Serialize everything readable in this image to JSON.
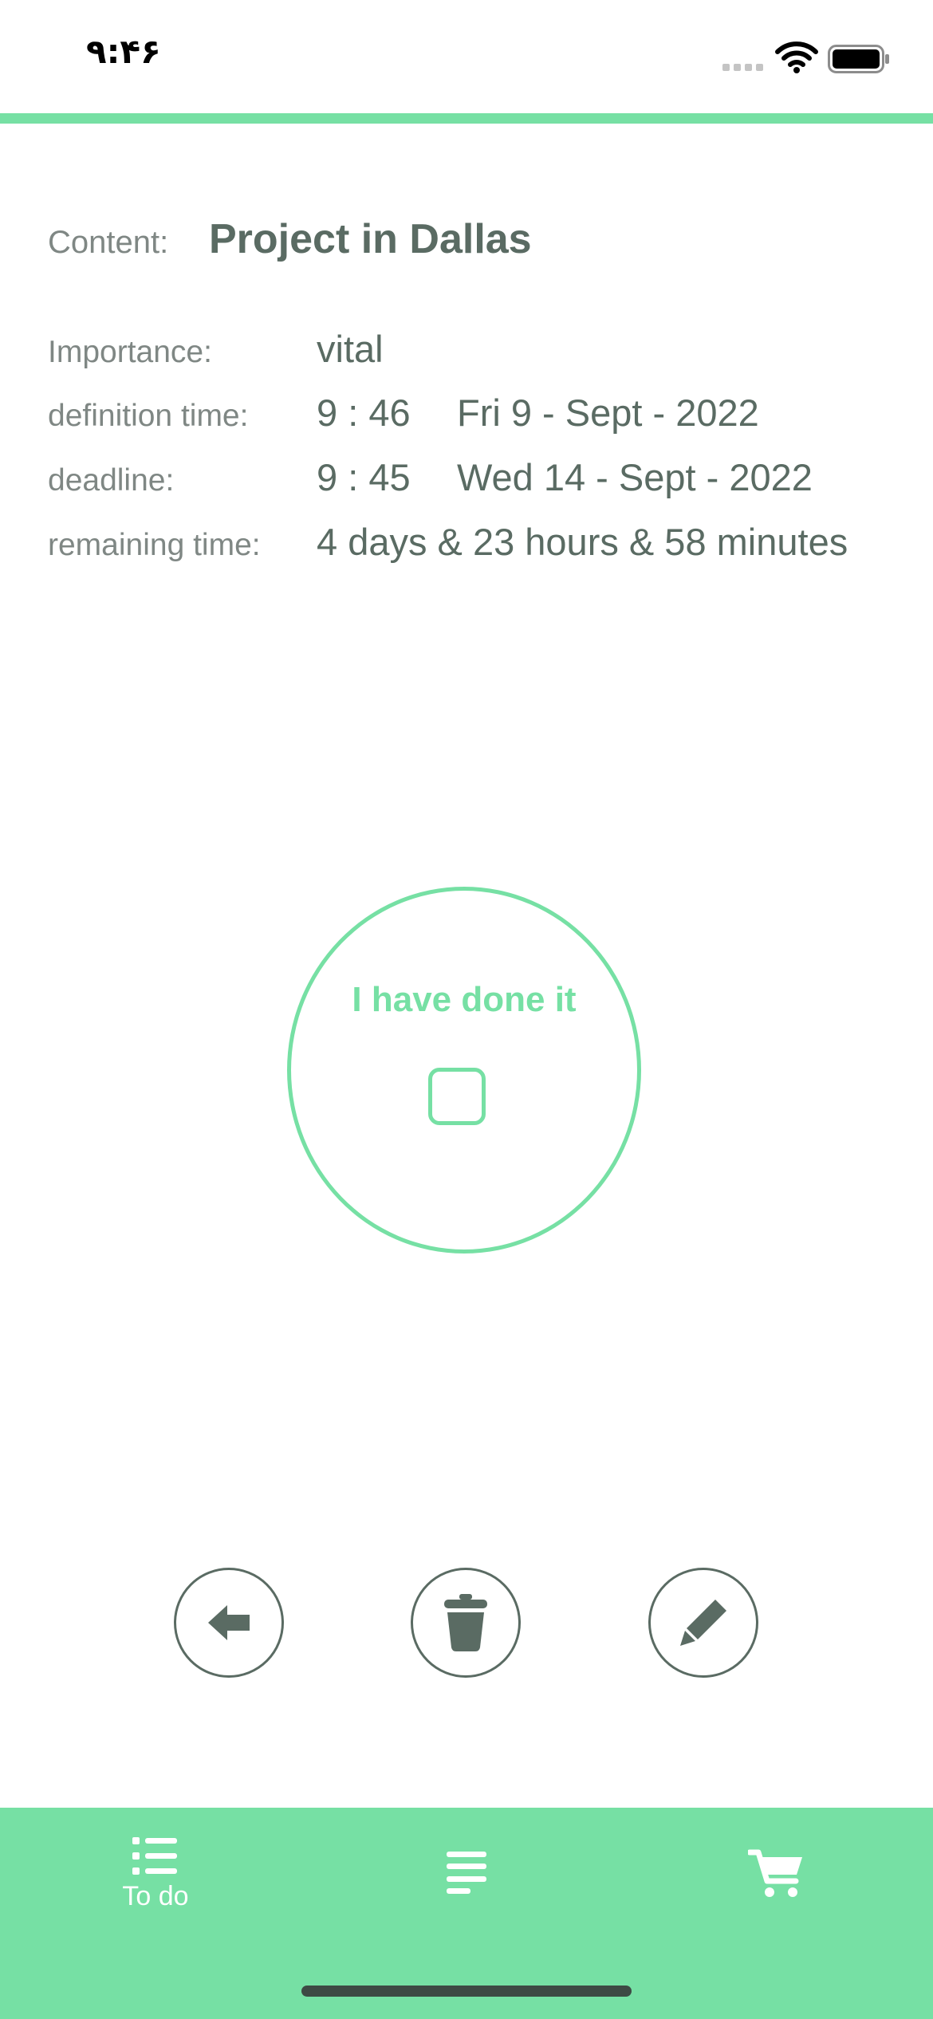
{
  "status_bar": {
    "time": "۹:۴۶"
  },
  "details": {
    "content_label": "Content:",
    "content_value": "Project in Dallas",
    "importance_label": "Importance:",
    "importance_value": "vital",
    "definition_label": "definition time:",
    "definition_time": "9 : 46",
    "definition_date": "Fri 9 - Sept - 2022",
    "deadline_label": "deadline:",
    "deadline_time": "9 : 45",
    "deadline_date": "Wed 14 - Sept - 2022",
    "remaining_label": "remaining time:",
    "remaining_value": "4 days & 23 hours & 58 minutes"
  },
  "done": {
    "label": "I have done it",
    "checked": false
  },
  "actions": [
    {
      "icon": "back-arrow-icon"
    },
    {
      "icon": "trash-icon"
    },
    {
      "icon": "pencil-icon"
    }
  ],
  "tab_bar": {
    "tabs": [
      {
        "label": "To do",
        "icon": "list-icon",
        "active": true
      },
      {
        "label": "",
        "icon": "lines-icon",
        "active": false
      },
      {
        "label": "",
        "icon": "cart-icon",
        "active": false
      }
    ]
  },
  "colors": {
    "accent": "#76e0a4",
    "text_primary": "#5a6b63",
    "text_secondary": "#7f8784",
    "background": "#ffffff"
  }
}
